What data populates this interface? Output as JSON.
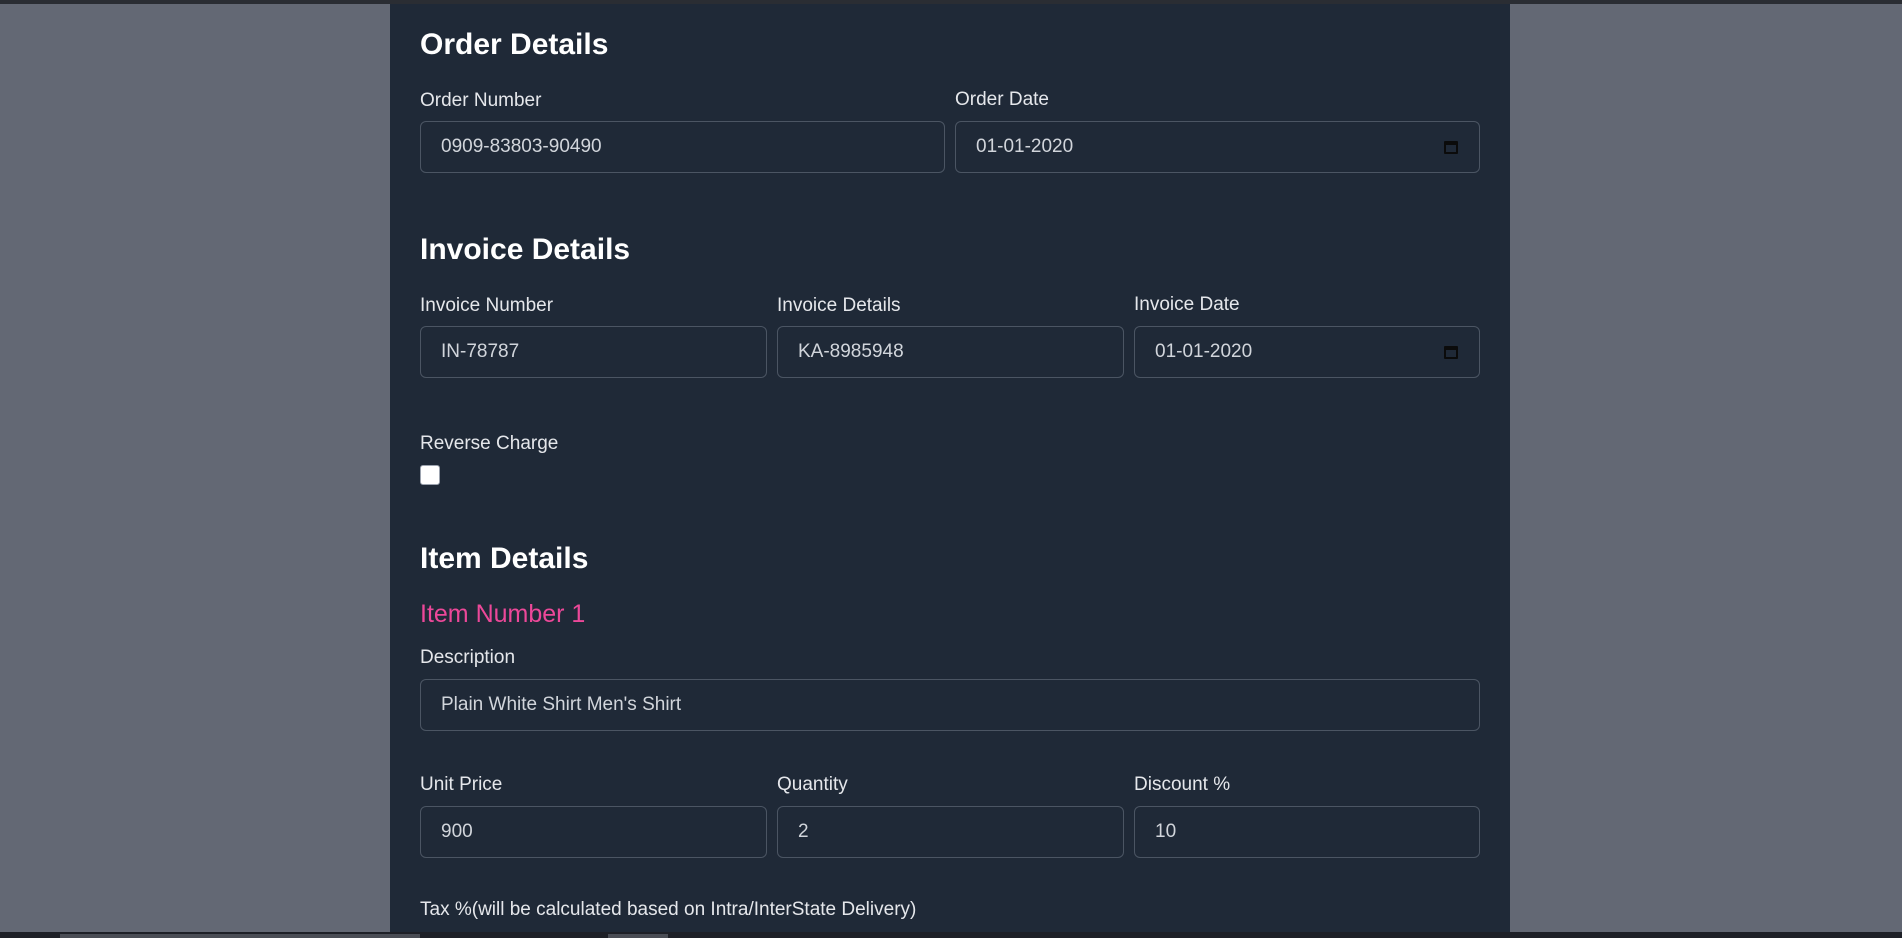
{
  "order": {
    "title": "Order Details",
    "order_number_label": "Order Number",
    "order_number_value": "0909-83803-90490",
    "order_date_label": "Order Date",
    "order_date_value": "01-01-2020"
  },
  "invoice": {
    "title": "Invoice Details",
    "invoice_number_label": "Invoice Number",
    "invoice_number_value": "IN-78787",
    "invoice_details_label": "Invoice Details",
    "invoice_details_value": "KA-8985948",
    "invoice_date_label": "Invoice Date",
    "invoice_date_value": "01-01-2020",
    "reverse_charge_label": "Reverse Charge",
    "reverse_charge_checked": false
  },
  "items": {
    "title": "Item Details",
    "item_number": "Item Number 1",
    "description_label": "Description",
    "description_value": "Plain White Shirt Men's Shirt",
    "unit_price_label": "Unit Price",
    "unit_price_value": "900",
    "quantity_label": "Quantity",
    "quantity_value": "2",
    "discount_label": "Discount %",
    "discount_value": "10",
    "tax_label": "Tax %(will be calculated based on Intra/InterState Delivery)"
  },
  "icons": {
    "date_picker": "calendar-icon"
  },
  "colors": {
    "page_bg": "#636874",
    "panel_bg": "#1f2937",
    "accent_pink": "#ec4899",
    "field_border": "#4b5563"
  }
}
